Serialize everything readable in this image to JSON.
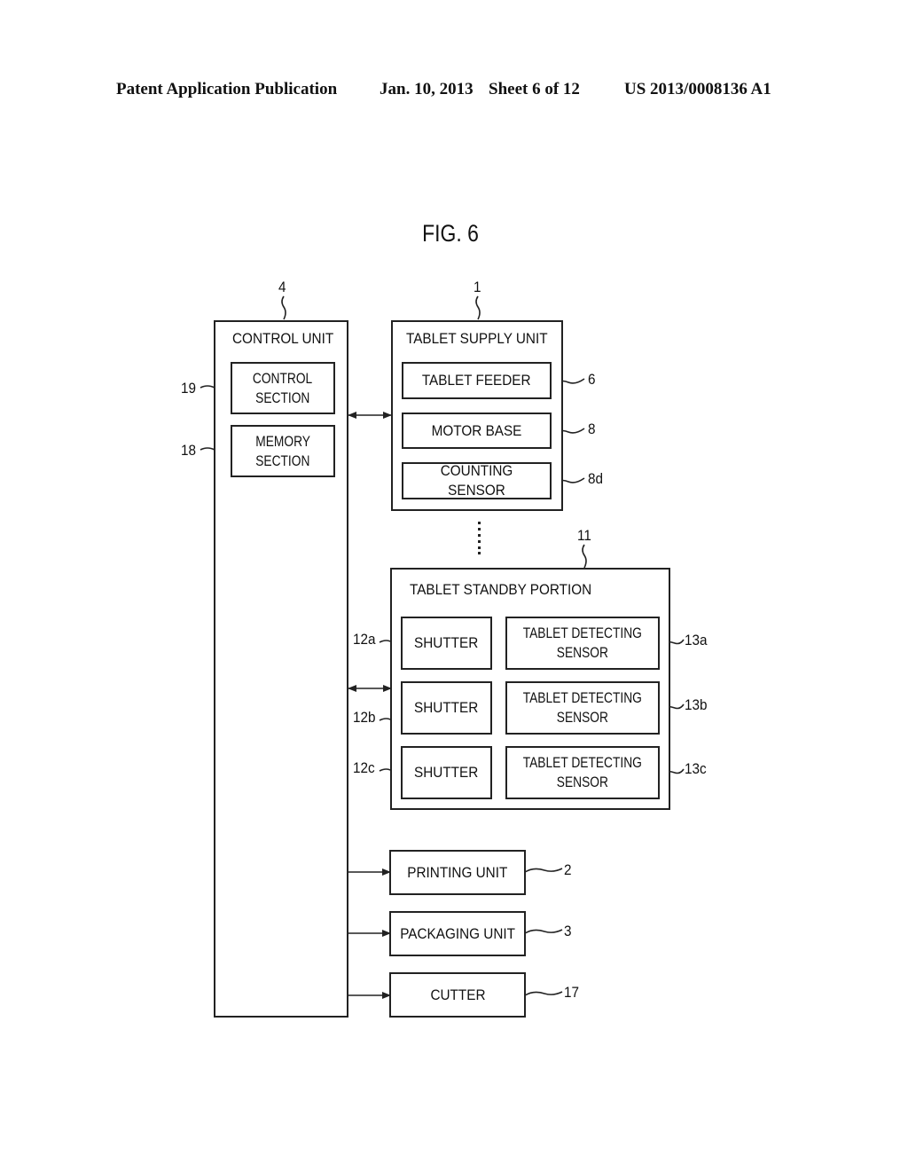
{
  "header": {
    "publication": "Patent Application Publication",
    "date": "Jan. 10, 2013",
    "sheet": "Sheet 6 of 12",
    "number": "US 2013/0008136 A1"
  },
  "figure": {
    "title": "FIG. 6"
  },
  "control_unit": {
    "ref": "4",
    "title": "CONTROL UNIT",
    "control_section": {
      "ref": "19",
      "line1": "CONTROL",
      "line2": "SECTION"
    },
    "memory_section": {
      "ref": "18",
      "line1": "MEMORY",
      "line2": "SECTION"
    }
  },
  "tablet_supply_unit": {
    "ref": "1",
    "title": "TABLET SUPPLY UNIT",
    "items": [
      {
        "label": "TABLET FEEDER",
        "ref": "6"
      },
      {
        "label": "MOTOR BASE",
        "ref": "8"
      },
      {
        "label": "COUNTING SENSOR",
        "ref": "8d"
      }
    ]
  },
  "tablet_standby_portion": {
    "ref": "11",
    "title": "TABLET STANDBY PORTION",
    "rows": [
      {
        "shutter": "SHUTTER",
        "shutter_ref": "12a",
        "sensor_line1": "TABLET DETECTING",
        "sensor_line2": "SENSOR",
        "sensor_ref": "13a"
      },
      {
        "shutter": "SHUTTER",
        "shutter_ref": "12b",
        "sensor_line1": "TABLET DETECTING",
        "sensor_line2": "SENSOR",
        "sensor_ref": "13b"
      },
      {
        "shutter": "SHUTTER",
        "shutter_ref": "12c",
        "sensor_line1": "TABLET DETECTING",
        "sensor_line2": "SENSOR",
        "sensor_ref": "13c"
      }
    ]
  },
  "outputs": [
    {
      "label": "PRINTING UNIT",
      "ref": "2"
    },
    {
      "label": "PACKAGING UNIT",
      "ref": "3"
    },
    {
      "label": "CUTTER",
      "ref": "17"
    }
  ]
}
